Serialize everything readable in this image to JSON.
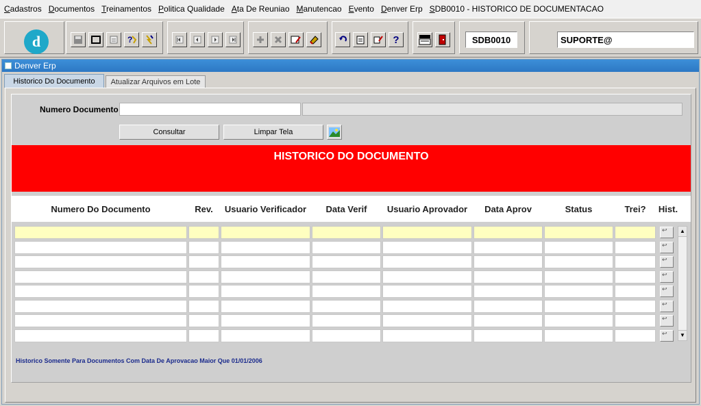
{
  "menu": [
    "Cadastros",
    "Documentos",
    "Treinamentos",
    "Politica Qualidade",
    "Ata De Reuniao",
    "Manutencao",
    "Evento",
    "Denver Erp",
    "SDB0010 - HISTORICO DE DOCUMENTACAO"
  ],
  "toolbar": {
    "form_code": "SDB0010",
    "user": "SUPORTE@",
    "logo_letter": "d",
    "help_glyph": "?"
  },
  "window": {
    "title": "Denver Erp"
  },
  "tabs": [
    {
      "label": "Historico Do Documento",
      "active": true
    },
    {
      "label": "Atualizar Arquivos em Lote",
      "active": false
    }
  ],
  "form": {
    "numero_label": "Numero Documento",
    "numero_value": "",
    "consultar_label": "Consultar",
    "limpar_label": "Limpar Tela"
  },
  "banner": {
    "title": "HISTORICO DO DOCUMENTO"
  },
  "grid": {
    "columns": [
      "Numero Do Documento",
      "Rev.",
      "Usuario Verificador",
      "Data Verif",
      "Usuario Aprovador",
      "Data Aprov",
      "Status",
      "Trei?",
      "Hist."
    ],
    "row_count": 8,
    "selected_row": 0
  },
  "footer_note": "Historico Somente Para Documentos Com Data De Aprovacao Maior Que 01/01/2006",
  "colors": {
    "banner": "#ff0000",
    "title_bar": "#2d78c4",
    "selected_row": "#ffffc0",
    "logo": "#1fa8c9"
  }
}
